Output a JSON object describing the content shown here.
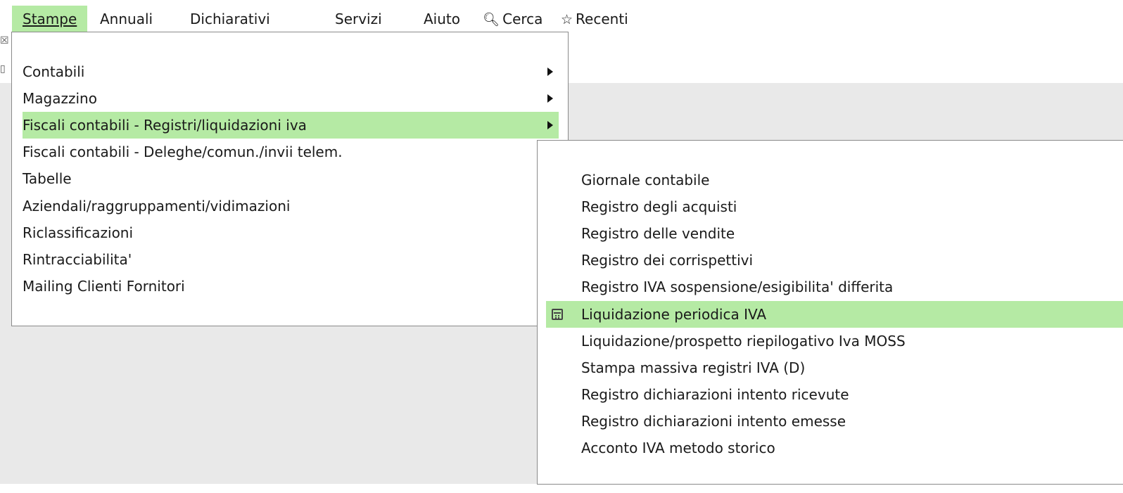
{
  "menubar": {
    "items": [
      {
        "label": "Stampe"
      },
      {
        "label": "Annuali"
      },
      {
        "label": "Dichiarativi"
      },
      {
        "label": "Servizi"
      },
      {
        "label": "Aiuto"
      },
      {
        "label": "Cerca",
        "icon": "search-icon"
      },
      {
        "label": "Recenti",
        "icon": "star-icon"
      }
    ]
  },
  "stampe_menu": {
    "items": [
      {
        "label": "Contabili",
        "submenu": true
      },
      {
        "label": "Magazzino",
        "submenu": true
      },
      {
        "label": "Fiscali contabili - Registri/liquidazioni iva",
        "submenu": true,
        "highlighted": true
      },
      {
        "label": "Fiscali contabili - Deleghe/comun./invii telem."
      },
      {
        "label": "Tabelle"
      },
      {
        "label": "Aziendali/raggruppamenti/vidimazioni"
      },
      {
        "label": "Riclassificazioni"
      },
      {
        "label": "Rintracciabilita'"
      },
      {
        "label": "Mailing Clienti Fornitori"
      }
    ]
  },
  "iva_submenu": {
    "items": [
      {
        "label": "Giornale contabile"
      },
      {
        "label": "Registro degli acquisti"
      },
      {
        "label": "Registro delle vendite"
      },
      {
        "label": "Registro dei corrispettivi"
      },
      {
        "label": "Registro IVA sospensione/esigibilita' differita"
      },
      {
        "label": "Liquidazione periodica IVA",
        "highlighted": true,
        "icon": "calendar-icon"
      },
      {
        "label": "Liquidazione/prospetto riepilogativo Iva MOSS"
      },
      {
        "label": "Stampa massiva registri IVA (D)"
      },
      {
        "label": "Registro dichiarazioni intento ricevute"
      },
      {
        "label": "Registro dichiarazioni intento emesse"
      },
      {
        "label": "Acconto IVA metodo storico"
      }
    ]
  },
  "colors": {
    "highlight": "#b5eaa4",
    "background_panel": "#e9e9e9"
  }
}
